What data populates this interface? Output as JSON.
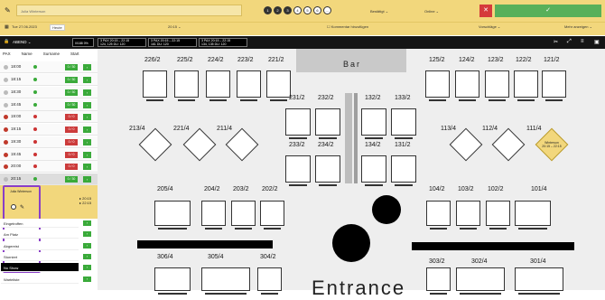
{
  "header": {
    "search_text": "Julia Winterson",
    "party_pills": [
      "1",
      "2",
      "3",
      "4",
      "5",
      "6",
      "…"
    ],
    "status_select": "Bestätigt",
    "online_select": "Online",
    "close_label": "✕",
    "confirm_label": "✓",
    "date": "Tue 27.06.2023",
    "today_label": "Heute",
    "time": "20:15",
    "comment_label": "Kommentar hinzufügen",
    "suggestions_label": "Vorschläge",
    "more_label": "Mehr anzeigen"
  },
  "darkbar": {
    "area": "ABEND",
    "count_badge": "0/188 0%",
    "boxes": [
      {
        "a": "3 PAX",
        "b": "20:15 – 22:15",
        "c": "124, 125",
        "d": "DU: 120"
      },
      {
        "a": "3 PAX",
        "b": "20:15 – 22:15",
        "c": "161",
        "d": "DU: 120"
      },
      {
        "a": "3 PAX",
        "b": "20:15 – 22:15",
        "c": "134, 135",
        "d": "DU: 120"
      }
    ]
  },
  "sidebar": {
    "columns": [
      "PAX",
      "Name",
      "Surname",
      "Start"
    ],
    "slots": [
      {
        "time": "18:00",
        "count": "0 / 30",
        "state": "green"
      },
      {
        "time": "18:15",
        "count": "0 / 30",
        "state": "green"
      },
      {
        "time": "18:30",
        "count": "0 / 30",
        "state": "green"
      },
      {
        "time": "18:45",
        "count": "0 / 30",
        "state": "green"
      },
      {
        "time": "19:00",
        "count": "0 / 0",
        "state": "red"
      },
      {
        "time": "19:15",
        "count": "0 / 0",
        "state": "red"
      },
      {
        "time": "19:30",
        "count": "0 / 0",
        "state": "red"
      },
      {
        "time": "19:45",
        "count": "0 / 0",
        "state": "red"
      },
      {
        "time": "20:00",
        "count": "0 / 0",
        "state": "red"
      },
      {
        "time": "20:15",
        "count": "0 / 30",
        "state": "green"
      }
    ],
    "booking": {
      "name": "Julia Winterson",
      "start": "20:15",
      "end": "22:15"
    },
    "status_menu": [
      "Eingetroffen",
      "Am Platz",
      "Abgereist",
      "Storniert",
      "No Show",
      "Warteliste"
    ],
    "status_selected": "No Show"
  },
  "floor": {
    "bar_label": "Bar",
    "entrance_label": "Entrance",
    "tables_top": [
      "226/2",
      "225/2",
      "224/2",
      "223/2",
      "221/2",
      "125/2",
      "124/2",
      "123/2",
      "122/2",
      "121/2"
    ],
    "tables_center": [
      "231/2",
      "232/2",
      "132/2",
      "133/2",
      "233/2",
      "234/2",
      "134/2",
      "131/2"
    ],
    "diamonds": [
      "213/4",
      "221/4",
      "211/4",
      "113/4",
      "112/4",
      "111/4"
    ],
    "row_mid": [
      "205/4",
      "204/2",
      "203/2",
      "202/2",
      "104/2",
      "103/2",
      "102/2",
      "101/4"
    ],
    "row_bottom": [
      "306/4",
      "305/4",
      "304/2",
      "303/2",
      "302/4",
      "301/4"
    ],
    "highlight_name": "Winterson",
    "highlight_time": "20:15 – 22:15"
  },
  "colors": {
    "header": "#f2d77c",
    "green": "#3aaa3a",
    "red": "#cc3b3b",
    "accent": "#8a3fc7"
  }
}
